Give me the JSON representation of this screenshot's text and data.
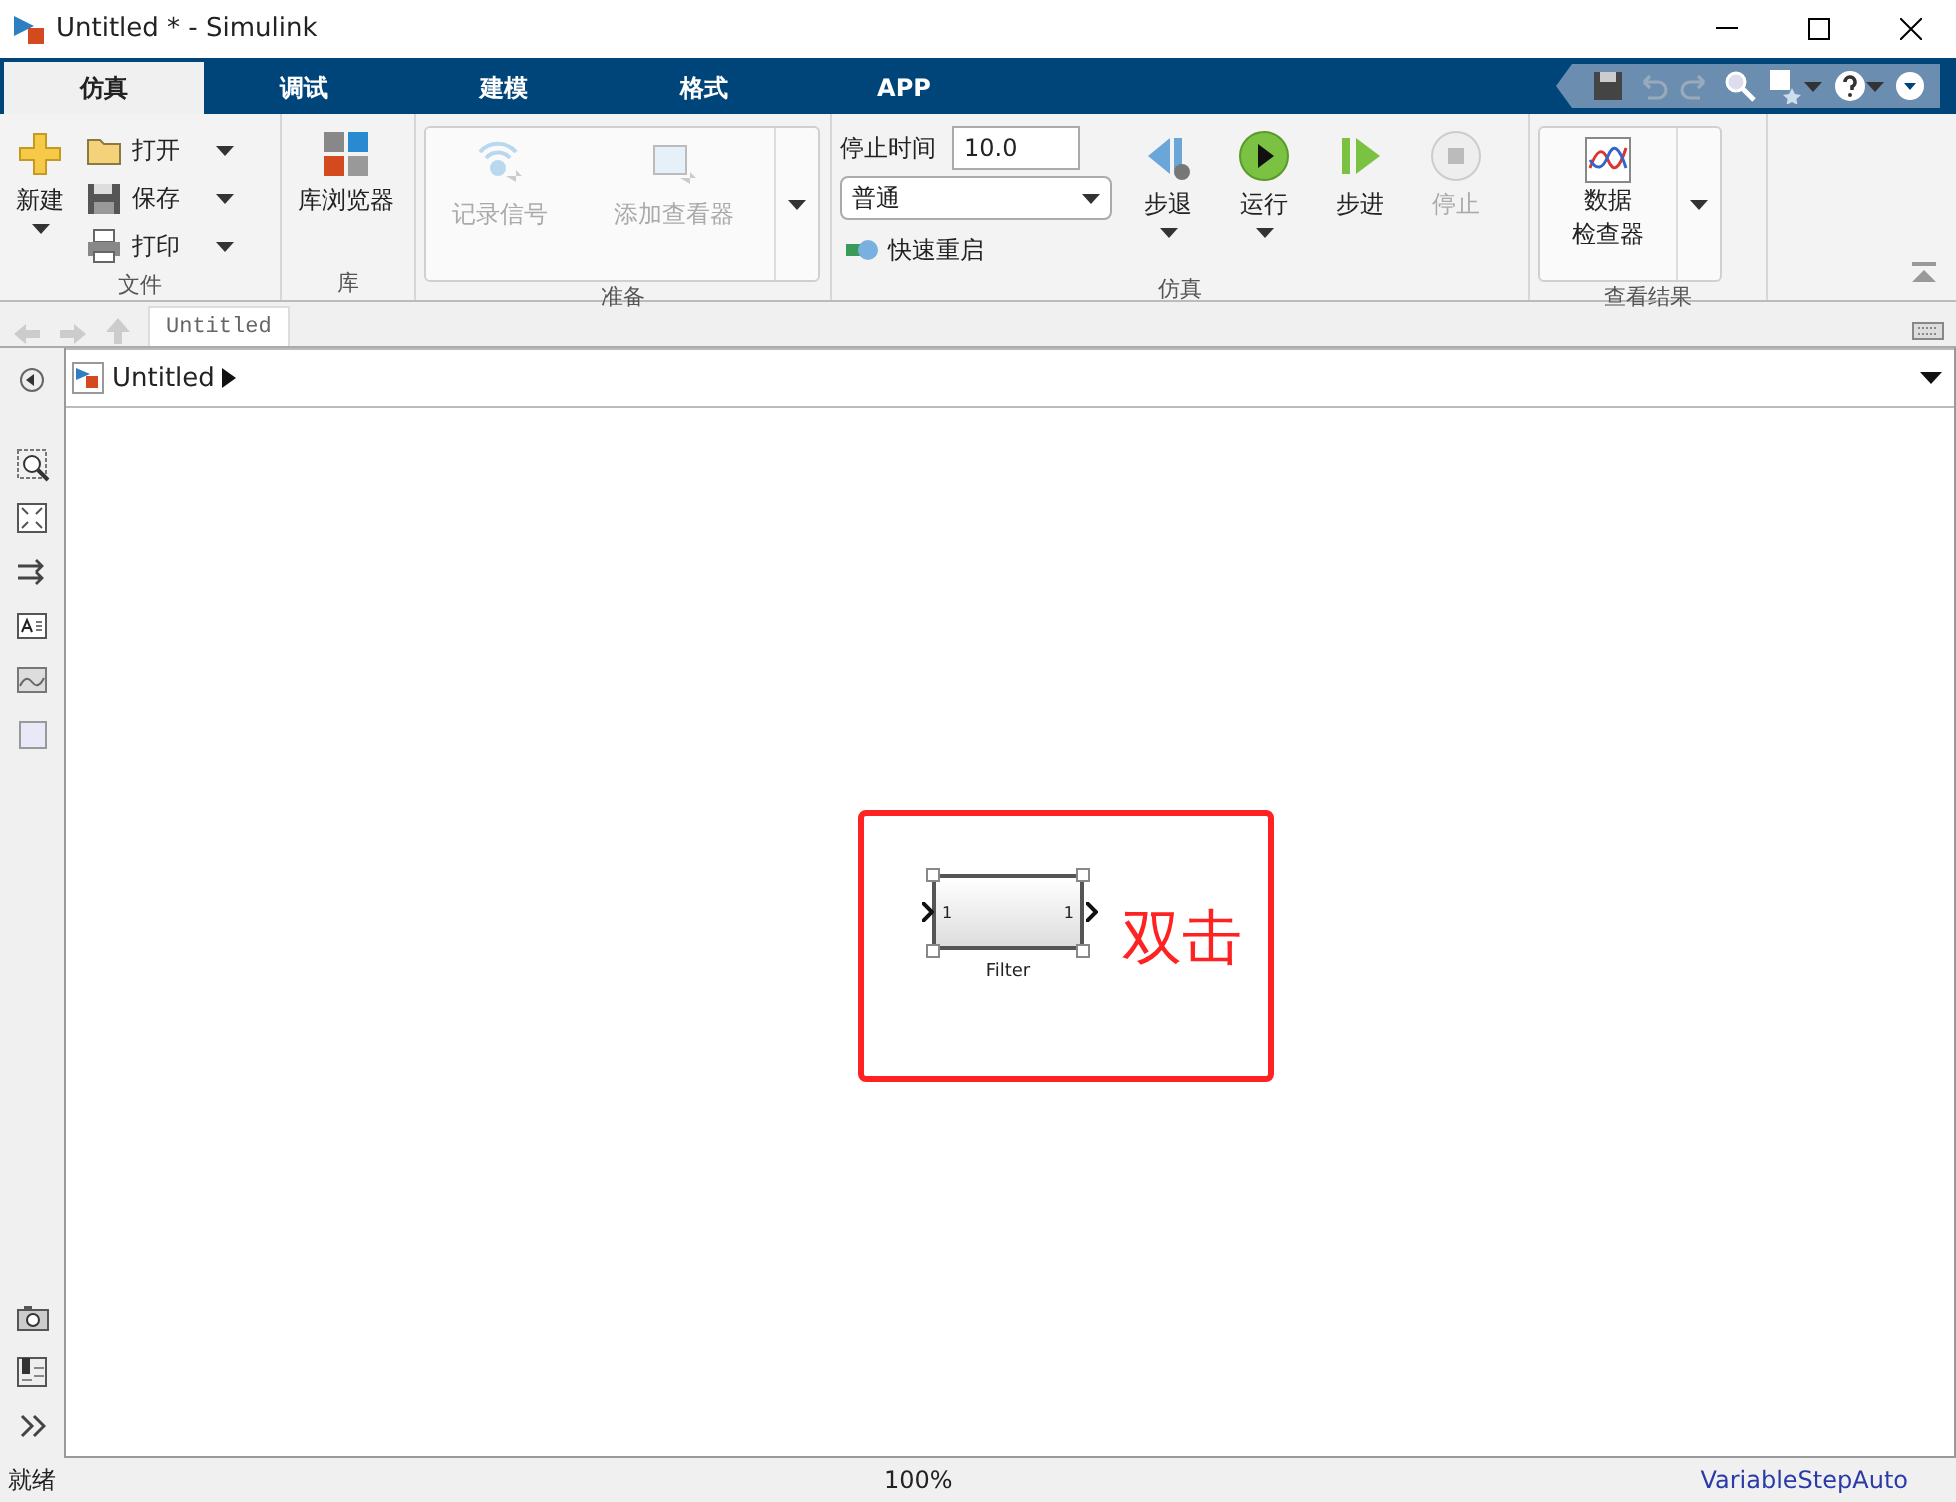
{
  "window": {
    "title": "Untitled * - Simulink"
  },
  "tabs": [
    {
      "label": "仿真",
      "selected": true
    },
    {
      "label": "调试",
      "selected": false
    },
    {
      "label": "建模",
      "selected": false
    },
    {
      "label": "格式",
      "selected": false
    },
    {
      "label": "APP",
      "selected": false
    }
  ],
  "ribbon": {
    "file": {
      "label": "文件",
      "new": "新建",
      "items": [
        {
          "kind": "open",
          "label": "打开"
        },
        {
          "kind": "save",
          "label": "保存"
        },
        {
          "kind": "print",
          "label": "打印"
        }
      ]
    },
    "library": {
      "label": "库",
      "button": "库浏览器"
    },
    "prepare": {
      "label": "准备",
      "buttons": [
        {
          "kind": "log",
          "label": "记录信号",
          "disabled": true
        },
        {
          "kind": "viewer",
          "label": "添加查看器",
          "disabled": true
        }
      ]
    },
    "simulate": {
      "label": "仿真",
      "stop_time_label": "停止时间",
      "stop_time": "10.0",
      "mode": "普通",
      "fast_restart": "快速重启",
      "buttons": [
        {
          "kind": "step-back",
          "label": "步退",
          "disabled": false,
          "menu": true
        },
        {
          "kind": "run",
          "label": "运行",
          "disabled": false,
          "menu": true
        },
        {
          "kind": "step-forward",
          "label": "步进",
          "disabled": false,
          "menu": false
        },
        {
          "kind": "stop",
          "label": "停止",
          "disabled": true,
          "menu": false
        }
      ]
    },
    "review": {
      "label": "查看结果",
      "button_lines": [
        "数据",
        "检查器"
      ]
    }
  },
  "nav": {
    "tab": "Untitled"
  },
  "breadcrumb": {
    "model": "Untitled"
  },
  "canvas": {
    "block": {
      "name": "Filter",
      "in_port": "1",
      "out_port": "1",
      "selected": true
    },
    "annotation": {
      "text": "双击"
    }
  },
  "status_bar": {
    "state": "就绪",
    "zoom": "100%",
    "solver": "VariableStepAuto"
  }
}
